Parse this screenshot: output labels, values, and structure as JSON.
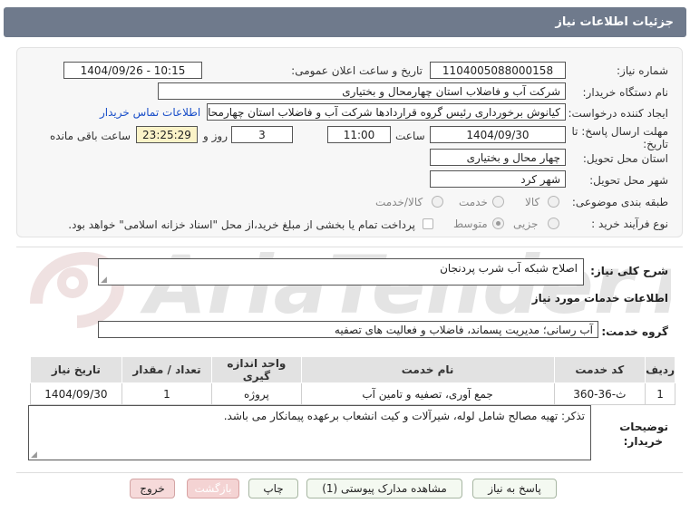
{
  "header": {
    "title": "جزئیات اطلاعات نیاز"
  },
  "fields": {
    "need_number_label": "شماره نیاز:",
    "need_number": "1104005088000158",
    "announce_label": "تاریخ و ساعت اعلان عمومی:",
    "announce_value": "1404/09/26 - 10:15",
    "buyer_org_label": "نام دستگاه خریدار:",
    "buyer_org": "شرکت آب و فاضلاب استان چهارمحال و بختیاری",
    "creator_label": "ایجاد کننده درخواست:",
    "creator": "کیانوش برخورداری رئیس گروه قراردادها شرکت آب و فاضلاب استان چهارمحال و",
    "contact_link": "اطلاعات تماس خریدار",
    "deadline_label_1": "مهلت ارسال پاسخ: تا",
    "deadline_label_2": "تاریخ:",
    "deadline_date": "1404/09/30",
    "time_label": "ساعت",
    "deadline_time": "11:00",
    "days_value": "3",
    "days_label": "روز و",
    "remaining_time": "23:25:29",
    "remaining_label": "ساعت باقی مانده",
    "province_label": "استان محل تحویل:",
    "province": "چهار محال و بختیاری",
    "city_label": "شهر محل تحویل:",
    "city": "شهر کرد",
    "category_label": "طبقه بندی موضوعی:",
    "category_options": [
      "کالا",
      "خدمت",
      "کالا/خدمت"
    ],
    "process_label": "نوع فرآیند خرید :",
    "process_options": [
      "جزیی",
      "متوسط"
    ],
    "payment_note": "پرداخت تمام یا بخشی از مبلغ خرید،از محل \"اسناد خزانه اسلامی\" خواهد بود."
  },
  "description": {
    "label": "شرح کلی نیاز:",
    "value": "اصلاح شبکه آب شرب پردنجان"
  },
  "services": {
    "section_title": "اطلاعات خدمات مورد نیاز",
    "group_label": "گروه خدمت:",
    "group_value": "آب رسانی؛ مدیریت پسماند، فاضلاب و فعالیت های تصفیه",
    "columns": [
      "ردیف",
      "کد خدمت",
      "نام خدمت",
      "واحد اندازه گیری",
      "تعداد / مقدار",
      "تاریخ نیاز"
    ],
    "rows": [
      [
        "1",
        "ث-36-360",
        "جمع آوری، تصفیه و تامین آب",
        "پروژه",
        "1",
        "1404/09/30"
      ]
    ]
  },
  "buyer_notes": {
    "label_line1": "توضیحات",
    "label_line2": "خریدار:",
    "value": "تذکر: تهیه مصالح شامل لوله، شیرآلات و کیت انشعاب برعهده پیمانکار می باشد."
  },
  "watermark": {
    "text": "AriaTender.net"
  },
  "buttons": {
    "reply": "پاسخ به نیاز",
    "attachments": "مشاهده مدارک پیوستی (1)",
    "print": "چاپ",
    "back": "بازگشت",
    "exit": "خروج"
  },
  "colors": {
    "header_bg": "#6f7a8c",
    "highlight": "#fbf3c8",
    "link": "#1a4fc9",
    "watermark": "#dcdcdc"
  }
}
